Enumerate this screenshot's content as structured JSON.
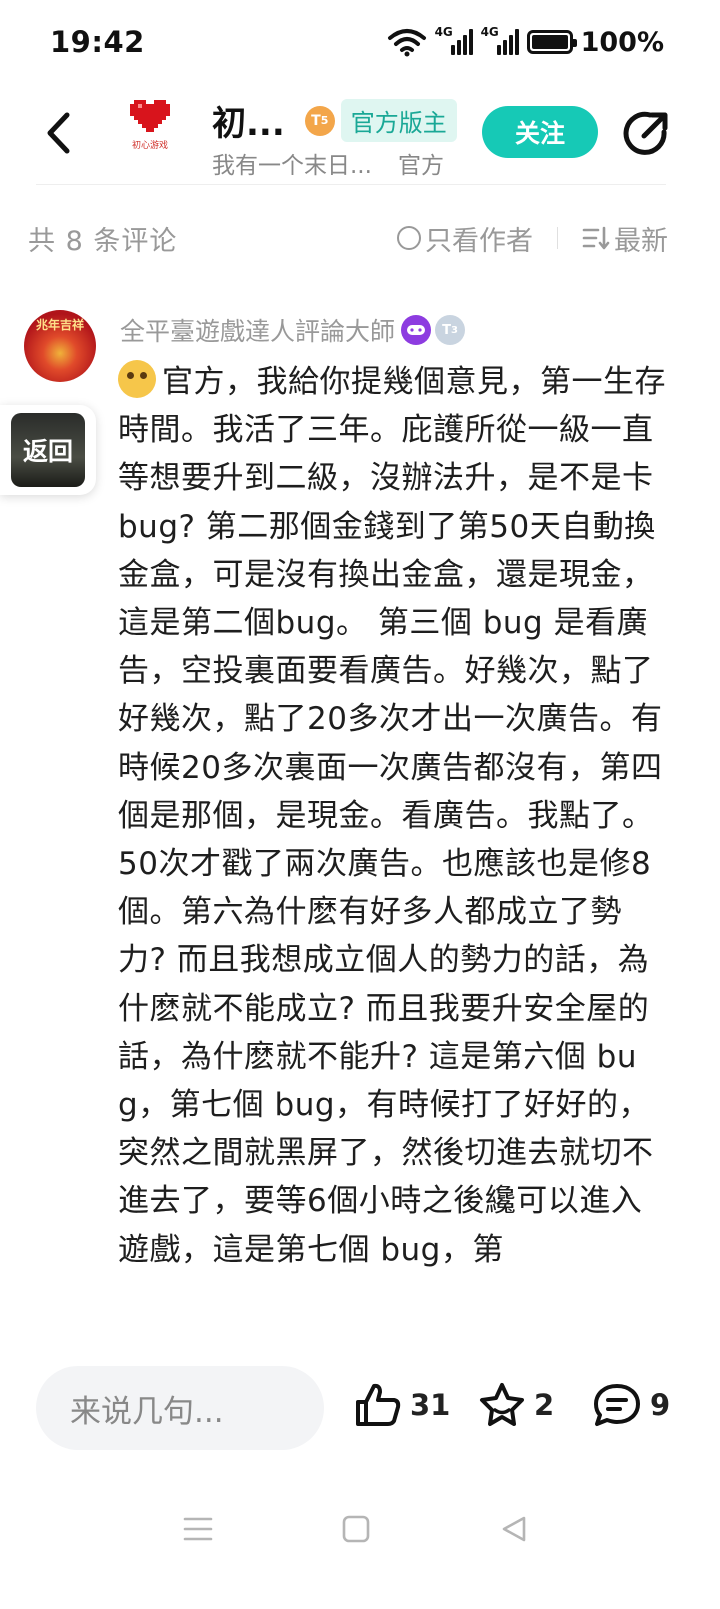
{
  "status_bar": {
    "time": "19:42",
    "network1": "4G",
    "network2": "4G",
    "battery": "100%"
  },
  "header": {
    "title": "初...",
    "level": "5",
    "role": "官方版主",
    "subtitle": "我有一个末日...",
    "subtitle_tag": "官方",
    "follow": "关注",
    "accent_color": "#16c9b6"
  },
  "filter": {
    "count_text": "共 8 条评论",
    "author_only": "只看作者",
    "sort": "最新"
  },
  "comment": {
    "user_name": "全平臺遊戲達人評論大師",
    "tier_badge": "3",
    "avatar_text": "兆年吉祥",
    "text": "官方，我給你提幾個意見，第一生存時間。我活了三年。庇護所從一級一直等想要升到二級，沒辦法升，是不是卡 bug? 第二那個金錢到了第50天自動換金盒，可是沒有換出金盒，還是現金，這是第二個bug。 第三個 bug 是看廣告，空投裏面要看廣告。好幾次，點了好幾次，點了20多次才出一次廣告。有時候20多次裏面一次廣告都沒有，第四個是那個，是現金。看廣告。我點了。50次才戳了兩次廣告。也應該也是修8個。第六為什麽有好多人都成立了勢力? 而且我想成立個人的勢力的話，為什麽就不能成立? 而且我要升安全屋的話，為什麽就不能升? 這是第六個 bug，第七個 bug，有時候打了好好的，突然之間就黑屏了，然後切進去就切不進去了，要等6個小時之後纔可以進入遊戲，這是第七個 bug，第"
  },
  "float_button": {
    "label": "返回"
  },
  "bottom_bar": {
    "input_placeholder": "来说几句...",
    "likes": "31",
    "favorites": "2",
    "replies": "9"
  }
}
